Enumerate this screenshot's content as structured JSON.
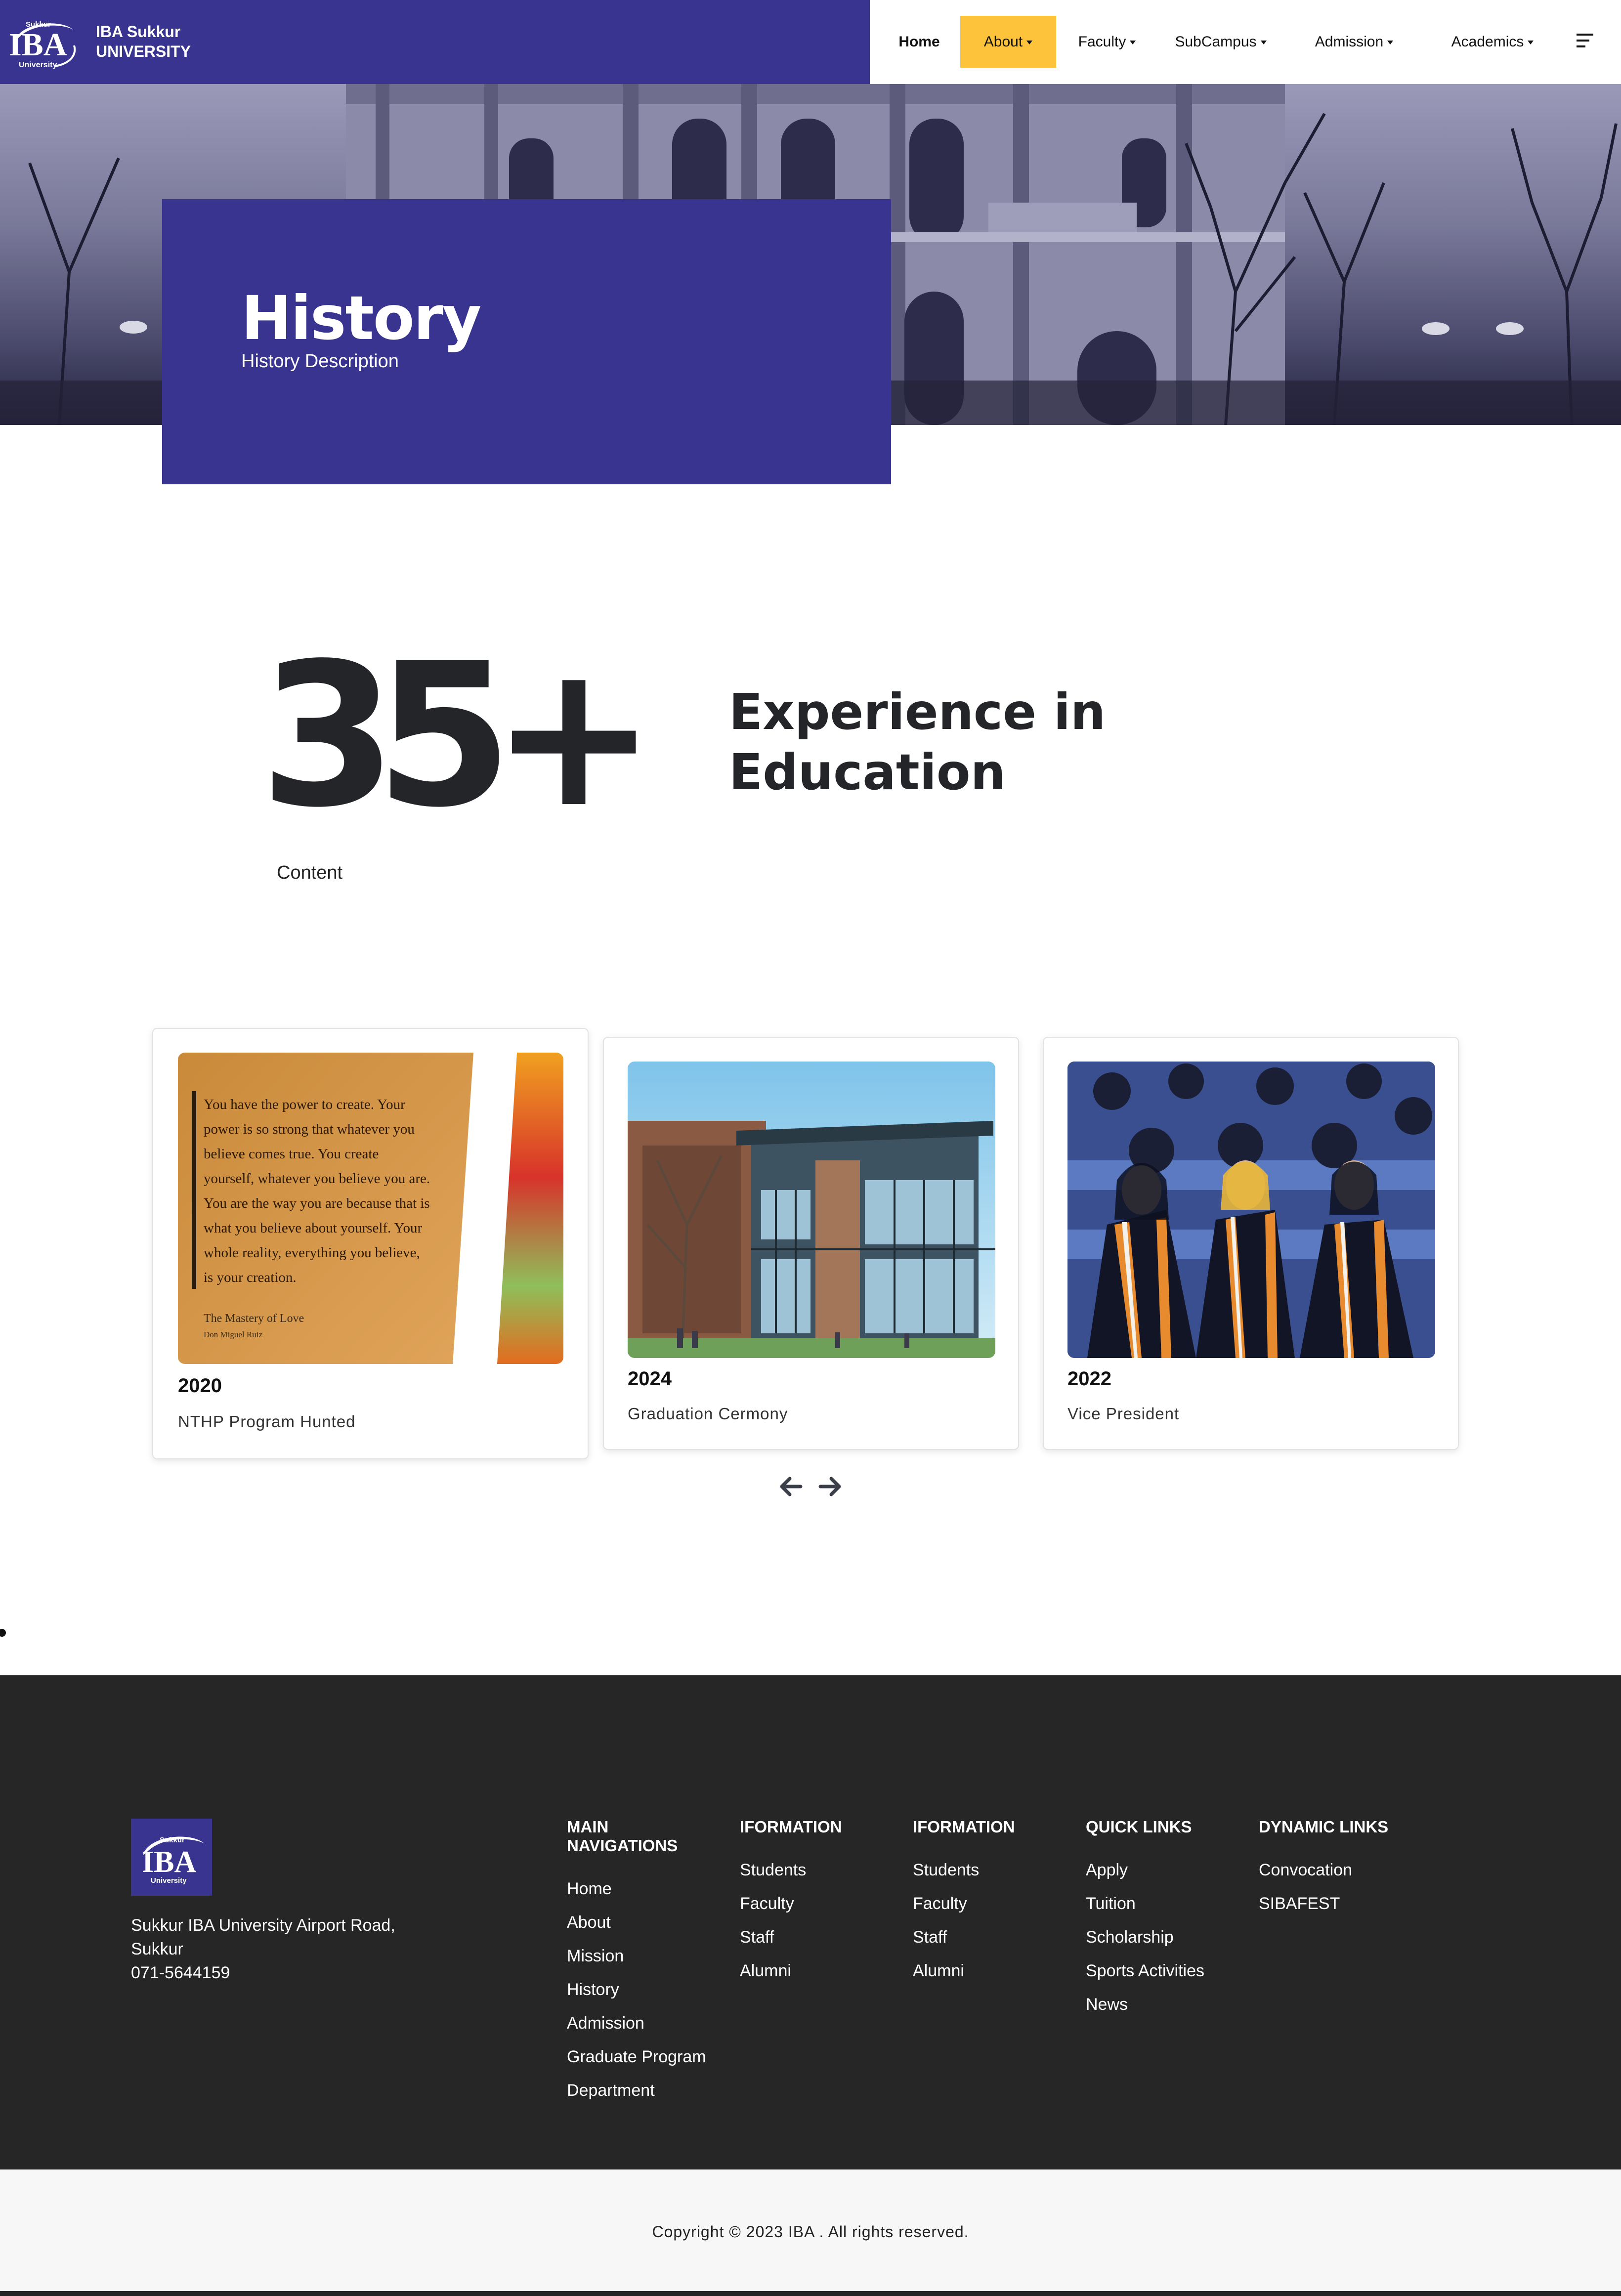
{
  "header": {
    "logo_text": "IBA",
    "logo_small_top": "Sukkur",
    "logo_small_bottom": "University",
    "brand_line1": "IBA Sukkur",
    "brand_line2": "UNIVERSITY",
    "nav": [
      {
        "label": "Home"
      },
      {
        "label": "About"
      },
      {
        "label": "Faculty"
      },
      {
        "label": "SubCampus"
      },
      {
        "label": "Admission"
      },
      {
        "label": "Academics"
      }
    ],
    "active_item": "About",
    "colors": {
      "brand": "#38348f",
      "accent": "#fdc33a"
    }
  },
  "hero": {
    "title": "History",
    "subtitle": "History Description"
  },
  "experience": {
    "number": "35+",
    "title_line1": "Experience in",
    "title_line2": "Education",
    "content": "Content"
  },
  "cards": [
    {
      "year": "2020",
      "title": "NTHP Program Hunted",
      "image": "quote-poster",
      "quote": "You have the power to create. Your power is so strong that whatever you believe comes true. You create yourself, whatever you believe you are. You are the way you are because that is what you believe about yourself. Your whole reality, everything you believe, is your creation.",
      "quote_source": "The Mastery of Love",
      "quote_author": "Don Miguel Ruiz"
    },
    {
      "year": "2024",
      "title": "Graduation Cermony",
      "image": "campus-building-photo"
    },
    {
      "year": "2022",
      "title": "Vice President",
      "image": "graduates-photo"
    }
  ],
  "carousel": {
    "prev_icon": "arrow-left-icon",
    "next_icon": "arrow-right-icon"
  },
  "footer": {
    "address_line1": "Sukkur IBA University Airport Road,",
    "address_line2": "Sukkur",
    "phone": "071-5644159",
    "columns": [
      {
        "heading_line1": "MAIN",
        "heading_line2": "NAVIGATIONS",
        "links": [
          "Home",
          "About",
          "Mission",
          "History",
          "Admission",
          "Graduate Program",
          "Department"
        ]
      },
      {
        "heading_line1": "IFORMATION",
        "heading_line2": "",
        "links": [
          "Students",
          "Faculty",
          "Staff",
          "Alumni"
        ]
      },
      {
        "heading_line1": "IFORMATION",
        "heading_line2": "",
        "links": [
          "Students",
          "Faculty",
          "Staff",
          "Alumni"
        ]
      },
      {
        "heading_line1": "QUICK LINKS",
        "heading_line2": "",
        "links": [
          "Apply",
          "Tuition",
          "Scholarship",
          "Sports Activities",
          "News"
        ]
      },
      {
        "heading_line1": "DYNAMIC LINKS",
        "heading_line2": "",
        "links": [
          "Convocation",
          "SIBAFEST"
        ]
      }
    ],
    "copyright": "Copyright © 2023 IBA . All rights reserved."
  }
}
